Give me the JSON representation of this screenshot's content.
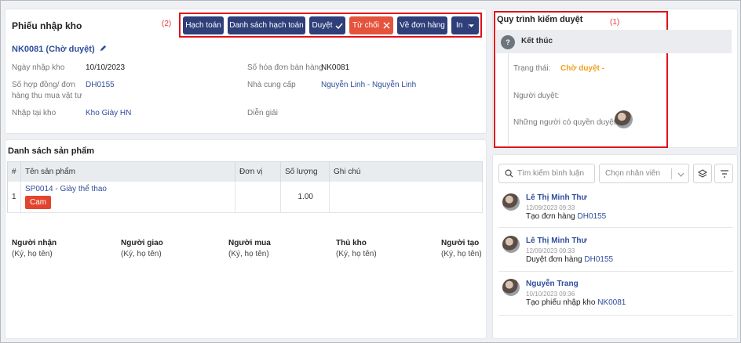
{
  "receipt": {
    "title": "Phiếu nhập kho",
    "code": "NK0081 (Chờ duyệt)",
    "fields": {
      "ngay_nhap_label": "Ngày nhập kho",
      "ngay_nhap_value": "10/10/2023",
      "so_hd_label_1": "Số hợp đồng/ đơn",
      "so_hd_label_2": "hàng thu mua vật tư",
      "so_hd_value": "DH0155",
      "nhap_tai_label": "Nhập tại kho",
      "nhap_tai_value": "Kho Giày HN",
      "so_hoa_don_label": "Số hóa đơn bán hàng",
      "so_hoa_don_value": "NK0081",
      "ncc_label": "Nhà cung cấp",
      "ncc_value": "Nguyễn Linh - Nguyễn Linh",
      "dien_giai_label": "Diễn giải"
    }
  },
  "annotations": {
    "two": "(2)",
    "one": "(1)"
  },
  "toolbar": {
    "hach_toan": "Hạch toán",
    "ds_hach_toan": "Danh sách hạch toán",
    "duyet": "Duyệt",
    "tu_choi": "Từ chối",
    "ve_don_hang": "Về đơn hàng",
    "in": "In"
  },
  "products": {
    "title": "Danh sách sản phẩm",
    "headers": [
      "#",
      "Tên sản phẩm",
      "Đơn vị",
      "Số lượng",
      "Ghi chú"
    ],
    "rows": [
      {
        "index": "1",
        "name": "SP0014 - Giày thể thao",
        "tag": "Cam",
        "unit": "",
        "qty": "1.00",
        "note": ""
      }
    ]
  },
  "signatures": [
    {
      "title": "Người nhận",
      "sub": "(Ký, họ tên)"
    },
    {
      "title": "Người giao",
      "sub": "(Ký, họ tên)"
    },
    {
      "title": "Người mua",
      "sub": "(Ký, họ tên)"
    },
    {
      "title": "Thủ kho",
      "sub": "(Ký, họ tên)"
    },
    {
      "title": "Người tạo",
      "sub": "(Ký, họ tên)"
    }
  ],
  "approval": {
    "title": "Quy trình kiểm duyệt",
    "step_badge": "?",
    "step_name": "Kết thúc",
    "status_label": "Trạng thái:",
    "status_value": "Chờ duyệt -",
    "approver_label": "Người duyệt:",
    "permitted_label": "Những người có quyền duyệt:"
  },
  "comments_panel": {
    "search_placeholder": "Tìm kiếm bình luận",
    "employee_placeholder": "Chọn nhân viên",
    "items": [
      {
        "name": "Lê Thị Minh Thư",
        "time": "12/09/2023 09:33",
        "text": "Tạo đơn hàng",
        "link": "DH0155"
      },
      {
        "name": "Lê Thị Minh Thư",
        "time": "12/09/2023 09:33",
        "text": "Duyệt đơn hàng",
        "link": "DH0155"
      },
      {
        "name": "Nguyễn Trang",
        "time": "10/10/2023 09:36",
        "text": "Tạo phiếu nhập kho",
        "link": "NK0081"
      }
    ]
  },
  "colors": {
    "primary": "#2e3f7a",
    "danger": "#e5533c",
    "warning": "#f0a020",
    "link": "#2f4d9c"
  }
}
